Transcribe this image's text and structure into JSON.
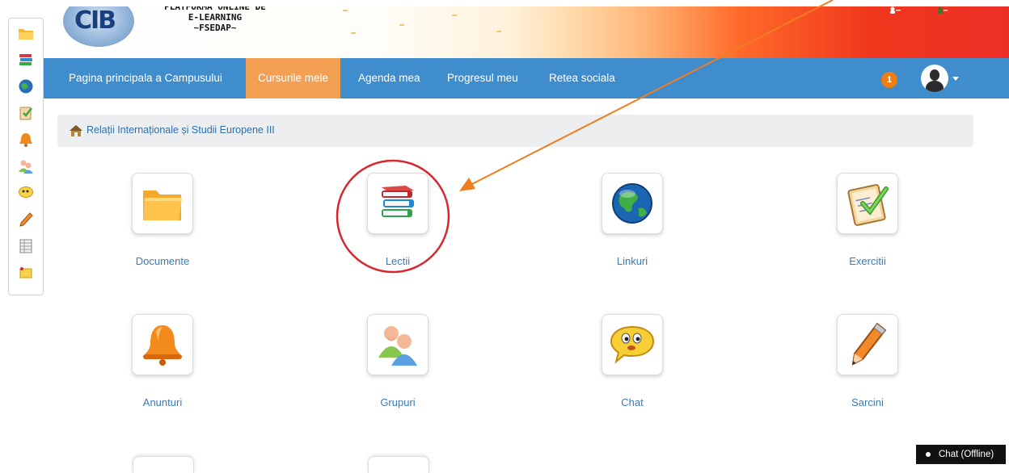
{
  "header": {
    "logo_text": "CIB",
    "brand_lines": [
      "PLATFORMA ONLINE DE",
      "E-LEARNING",
      "~FSEDAP~"
    ]
  },
  "nav": {
    "items": [
      {
        "label": "Pagina principala a Campusului",
        "active": false
      },
      {
        "label": "Cursurile mele",
        "active": true
      },
      {
        "label": "Agenda mea",
        "active": false
      },
      {
        "label": "Progresul meu",
        "active": false
      },
      {
        "label": "Retea sociala",
        "active": false
      }
    ],
    "notification_count": "1",
    "user_menu_icon": "user-avatar-icon"
  },
  "sidebar": {
    "items": [
      {
        "icon": "folder-icon"
      },
      {
        "icon": "books-icon"
      },
      {
        "icon": "globe-icon"
      },
      {
        "icon": "checklist-icon"
      },
      {
        "icon": "bell-icon"
      },
      {
        "icon": "group-icon"
      },
      {
        "icon": "chat-bubble-icon"
      },
      {
        "icon": "pencil-icon"
      },
      {
        "icon": "spreadsheet-icon"
      },
      {
        "icon": "note-icon"
      }
    ]
  },
  "breadcrumb": {
    "home_icon": "home-icon",
    "text": "Relații Internaționale și Studii Europene III"
  },
  "tools": [
    {
      "label": "Documente",
      "icon": "folder-icon"
    },
    {
      "label": "Lectii",
      "icon": "books-icon",
      "highlighted": true
    },
    {
      "label": "Linkuri",
      "icon": "globe-icon"
    },
    {
      "label": "Exercitii",
      "icon": "checklist-icon"
    },
    {
      "label": "Anunturi",
      "icon": "bell-icon"
    },
    {
      "label": "Grupuri",
      "icon": "group-icon"
    },
    {
      "label": "Chat",
      "icon": "chat-bubble-icon"
    },
    {
      "label": "Sarcini",
      "icon": "pencil-icon"
    }
  ],
  "chat_widget": {
    "label": "Chat (Offline)"
  },
  "colors": {
    "nav_bg": "#3f8dcc",
    "nav_active": "#f4a053",
    "link": "#3a7ab8",
    "annotation_circle": "#d7262e",
    "annotation_arrow": "#f07d22",
    "badge": "#f07e14"
  }
}
